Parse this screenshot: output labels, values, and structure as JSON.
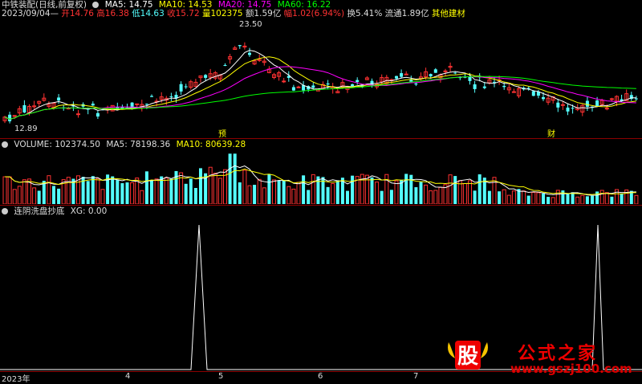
{
  "header": {
    "stock_name": "中铁装配(日线,前复权)",
    "ma": [
      {
        "label": "MA5: 14.75",
        "color": "#ffffff"
      },
      {
        "label": "MA10: 14.53",
        "color": "#ffff00"
      },
      {
        "label": "MA20: 14.75",
        "color": "#ff00ff"
      },
      {
        "label": "MA60: 16.22",
        "color": "#00ff00"
      }
    ]
  },
  "quote": {
    "date": "2023/09/04—",
    "open": "开14.76",
    "high": "高16.38",
    "low": "低14.63",
    "close": "收15.72",
    "volume": "量102375",
    "amount": "额1.59亿",
    "change": "幅1.02(6.94%)",
    "turnover": "换5.41%",
    "float_cap": "流通1.89亿",
    "industry": "其他建材"
  },
  "price_panel": {
    "high_marker": "23.50",
    "low_marker": "12.89",
    "event_1": "预",
    "event_2": "财"
  },
  "volume_panel": {
    "vol_label": "VOLUME: 102374.50",
    "ma5_label": "MA5: 78198.36",
    "ma10_label": "MA10: 80639.28"
  },
  "indicator_panel": {
    "name": "连阴洗盘抄底",
    "xg_label": "XG: 0.00"
  },
  "time_axis": {
    "labels": [
      "2023年",
      "4",
      "5",
      "6",
      "7"
    ]
  },
  "watermark": {
    "icon_text": "股",
    "title": "公式之家",
    "url": "www.gszj100.com"
  },
  "colors": {
    "up": "#ff3232",
    "down": "#54ffff",
    "ma5": "#ffffff",
    "ma10": "#ffff00",
    "ma20": "#ff00ff",
    "ma60": "#00ff00",
    "separator": "#8b0000"
  }
}
